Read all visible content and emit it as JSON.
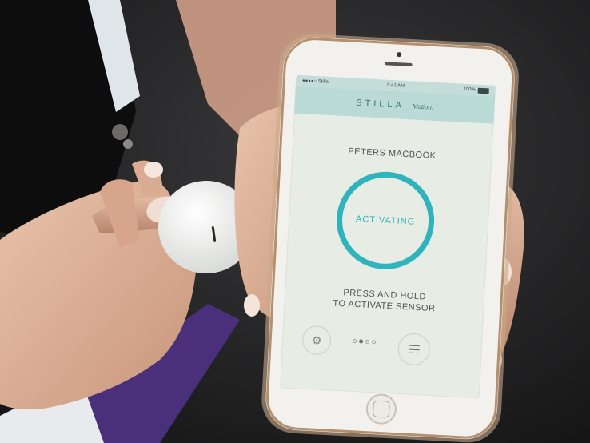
{
  "status_bar": {
    "carrier": "●●●●○ Stilla",
    "time": "9:41 AM",
    "battery": "100%"
  },
  "app": {
    "brand": "STILLA",
    "mode": "Motion."
  },
  "device": {
    "name": "PETERS MACBOOK"
  },
  "sensor": {
    "status": "ACTIVATING",
    "instruction_line1": "PRESS AND HOLD",
    "instruction_line2": "TO ACTIVATE SENSOR"
  },
  "pager": {
    "total": 4,
    "active": 1
  },
  "icons": {
    "settings": "gear-icon",
    "menu": "hamburger-menu-icon"
  },
  "colors": {
    "accent": "#2fb3bc",
    "header": "#b9dad5",
    "screen_bg": "#e7ece4"
  }
}
